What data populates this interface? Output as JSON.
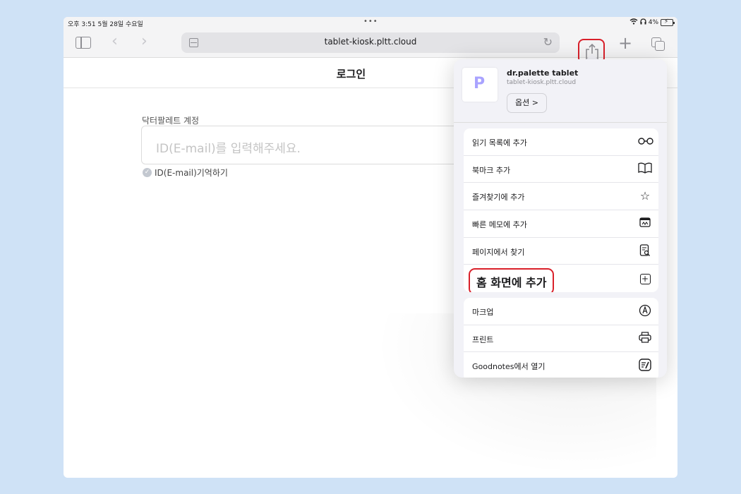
{
  "status_bar": {
    "time_date": "오후 3:51   5월 28일 수요일",
    "battery": "4%"
  },
  "browser": {
    "url": "tablet-kiosk.pltt.cloud"
  },
  "page": {
    "title": "로그인",
    "account_label": "닥터팔레트 계정",
    "id_placeholder": "ID(E-mail)를 입력해주세요.",
    "remember_label": "ID(E-mail)기억하기"
  },
  "share_sheet": {
    "thumb_letter": "P",
    "site_title": "dr.palette tablet",
    "site_url": "tablet-kiosk.pltt.cloud",
    "options_label": "옵션 >",
    "group1": [
      {
        "label": "읽기 목록에 추가",
        "icon": "glasses-icon"
      },
      {
        "label": "북마크 추가",
        "icon": "book-icon"
      },
      {
        "label": "즐겨찾기에 추가",
        "icon": "star-icon"
      },
      {
        "label": "빠른 메모에 추가",
        "icon": "quick-note-icon"
      },
      {
        "label": "페이지에서 찾기",
        "icon": "find-page-icon"
      },
      {
        "label": "홈 화면에 추가",
        "icon": "add-square-icon"
      }
    ],
    "group2": [
      {
        "label": "마크업",
        "icon": "markup-icon"
      },
      {
        "label": "프린트",
        "icon": "printer-icon"
      },
      {
        "label": "Goodnotes에서 열기",
        "icon": "goodnotes-icon"
      }
    ]
  },
  "colors": {
    "highlight": "#d9202a",
    "background": "#cfe2f6"
  }
}
